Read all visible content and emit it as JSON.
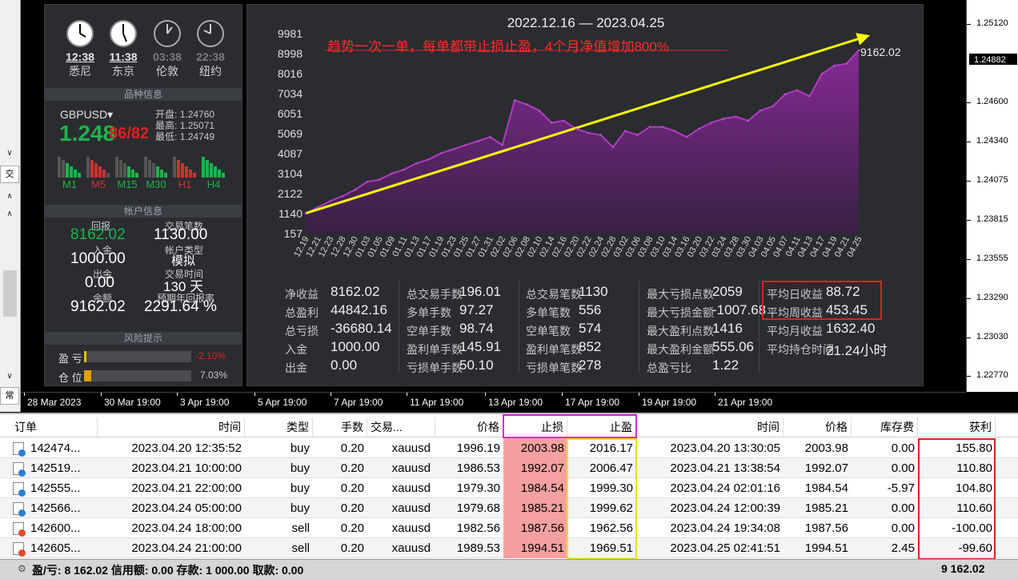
{
  "left_strip": {
    "tab1": "交",
    "tab2": "常"
  },
  "info": {
    "clocks": [
      {
        "time": "12:38",
        "city": "悉尼",
        "active": true
      },
      {
        "time": "11:38",
        "city": "东京",
        "active": true
      },
      {
        "time": "03:38",
        "city": "伦敦",
        "active": false
      },
      {
        "time": "22:38",
        "city": "纽约",
        "active": false
      }
    ],
    "sec_product": "品种信息",
    "symbol": "GBPUSD",
    "bid_big": "1.248",
    "bid_small": "86/82",
    "open_label": "开盘:",
    "open": "1.24760",
    "high_label": "最高:",
    "high": "1.25071",
    "low_label": "最低:",
    "low": "1.24749",
    "timeframes": [
      "M1",
      "M5",
      "M15",
      "M30",
      "H1",
      "H4"
    ],
    "sec_account": "帐户信息",
    "return_label": "回报",
    "return_value": "8162.02",
    "trades_label": "交易笔数",
    "trades_value": "1130.00",
    "deposit_label": "入金",
    "deposit_value": "1000.00",
    "acct_type_label": "帐户类型",
    "acct_type_value": "模拟",
    "withdraw_label": "出金",
    "withdraw_value": "0.00",
    "trade_time_label": "交易时间",
    "trade_time_value": "130 天",
    "balance_label": "余额",
    "balance_value": "9162.02",
    "annual_label": "预期年回报率",
    "annual_value": "2291.64 %",
    "sec_risk": "风险提示",
    "pl_label": "盈   亏",
    "pl_value": "-2.10%",
    "pl_fill": 0.021,
    "pos_label": "仓   位",
    "pos_value": "7.03%",
    "pos_fill": 0.0703
  },
  "chart": {
    "date_range": "2022.12.16 — 2023.04.25",
    "annotation": "趋势一次一单，每单都带止损止盈，4个月净值增加800%",
    "last_value_label": "9162.02",
    "y_ticks": [
      "9981",
      "8998",
      "8016",
      "7034",
      "6051",
      "5069",
      "4087",
      "3104",
      "2122",
      "1140",
      "157"
    ],
    "x_labels": [
      "12.19",
      "12.21",
      "12.23",
      "12.28",
      "12.30",
      "01.03",
      "01.05",
      "01.09",
      "01.11",
      "01.13",
      "01.17",
      "01.19",
      "01.23",
      "01.25",
      "01.27",
      "01.31",
      "02.02",
      "02.06",
      "02.08",
      "02.10",
      "02.14",
      "02.16",
      "02.20",
      "02.22",
      "02.24",
      "02.28",
      "03.02",
      "03.06",
      "03.08",
      "03.10",
      "03.14",
      "03.16",
      "03.20",
      "03.22",
      "03.24",
      "03.28",
      "03.30",
      "04.03",
      "04.05",
      "04.07",
      "04.11",
      "04.13",
      "04.17",
      "04.19",
      "04.21",
      "04.25"
    ]
  },
  "chart_data": {
    "type": "area",
    "x": [
      "12.19",
      "12.21",
      "12.23",
      "12.28",
      "12.30",
      "01.03",
      "01.05",
      "01.09",
      "01.11",
      "01.13",
      "01.17",
      "01.19",
      "01.23",
      "01.25",
      "01.27",
      "01.31",
      "02.02",
      "02.06",
      "02.08",
      "02.10",
      "02.14",
      "02.16",
      "02.20",
      "02.22",
      "02.24",
      "02.28",
      "03.02",
      "03.06",
      "03.08",
      "03.10",
      "03.14",
      "03.16",
      "03.20",
      "03.22",
      "03.24",
      "03.28",
      "03.30",
      "04.03",
      "04.05",
      "04.07",
      "04.11",
      "04.13",
      "04.17",
      "04.19",
      "04.21",
      "04.25"
    ],
    "series": [
      {
        "values": [
          1140,
          1450,
          1750,
          2000,
          2300,
          2700,
          2800,
          3100,
          3300,
          3600,
          3800,
          4100,
          4300,
          4500,
          4700,
          4900,
          4500,
          6700,
          6500,
          6200,
          5600,
          5700,
          5300,
          5100,
          5000,
          4400,
          5200,
          5000,
          5400,
          5400,
          5200,
          4900,
          5300,
          5600,
          5800,
          5900,
          5700,
          6200,
          6400,
          7000,
          7200,
          6900,
          8000,
          8400,
          8500,
          9162
        ]
      }
    ],
    "ylim": [
      157,
      9981
    ],
    "trend_arrow": {
      "from": 1150,
      "to": 9900
    }
  },
  "stats": {
    "col1": [
      [
        "净收益",
        "8162.02"
      ],
      [
        "总盈利",
        "44842.16"
      ],
      [
        "总亏损",
        "-36680.14"
      ],
      [
        "入金",
        "1000.00"
      ],
      [
        "出金",
        "0.00"
      ]
    ],
    "col2": [
      [
        "总交易手数",
        "196.01"
      ],
      [
        "多单手数",
        "97.27"
      ],
      [
        "空单手数",
        "98.74"
      ],
      [
        "盈利单手数",
        "145.91"
      ],
      [
        "亏损单手数",
        "50.10"
      ]
    ],
    "col3": [
      [
        "总交易笔数",
        "1130"
      ],
      [
        "多单笔数",
        "556"
      ],
      [
        "空单笔数",
        "574"
      ],
      [
        "盈利单笔数",
        "852"
      ],
      [
        "亏损单笔数",
        "278"
      ]
    ],
    "col4": [
      [
        "最大亏损点数",
        "2059"
      ],
      [
        "最大亏损金额",
        "-1007.68"
      ],
      [
        "最大盈利点数",
        "1416"
      ],
      [
        "最大盈利金额",
        "555.06"
      ],
      [
        "总盈亏比",
        "1.22"
      ]
    ],
    "col5": [
      [
        "平均日收益",
        "88.72"
      ],
      [
        "平均周收益",
        "453.45"
      ],
      [
        "平均月收益",
        "1632.40"
      ],
      [
        "平均持仓时间",
        "21.24小时"
      ]
    ]
  },
  "price_axis": {
    "labels": [
      "1.25120",
      "1.24600",
      "1.24340",
      "1.24075",
      "1.23815",
      "1.23555",
      "1.23290",
      "1.23030",
      "1.22770"
    ],
    "current": "1.24882"
  },
  "time_axis": [
    "28 Mar 2023",
    "30 Mar 19:00",
    "3 Apr 19:00",
    "5 Apr 19:00",
    "7 Apr 19:00",
    "11 Apr 19:00",
    "13 Apr 19:00",
    "17 Apr 19:00",
    "19 Apr 19:00",
    "21 Apr 19:00"
  ],
  "table": {
    "headers": [
      "订单",
      "时间",
      "类型",
      "手数",
      "交易...",
      "价格",
      "止损",
      "止盈",
      "时间",
      "价格",
      "库存费",
      "获利"
    ],
    "rows": [
      [
        "142474...",
        "2023.04.20 12:35:52",
        "buy",
        "0.20",
        "xauusd",
        "1996.19",
        "2003.98",
        "2016.17",
        "2023.04.20 13:30:05",
        "2003.98",
        "0.00",
        "155.80"
      ],
      [
        "142519...",
        "2023.04.21 10:00:00",
        "buy",
        "0.20",
        "xauusd",
        "1986.53",
        "1992.07",
        "2006.47",
        "2023.04.21 13:38:54",
        "1992.07",
        "0.00",
        "110.80"
      ],
      [
        "142555...",
        "2023.04.21 22:00:00",
        "buy",
        "0.20",
        "xauusd",
        "1979.30",
        "1984.54",
        "1999.30",
        "2023.04.24 02:01:16",
        "1984.54",
        "-5.97",
        "104.80"
      ],
      [
        "142566...",
        "2023.04.24 05:00:00",
        "buy",
        "0.20",
        "xauusd",
        "1979.68",
        "1985.21",
        "1999.62",
        "2023.04.24 12:00:39",
        "1985.21",
        "0.00",
        "110.60"
      ],
      [
        "142600...",
        "2023.04.24 18:00:00",
        "sell",
        "0.20",
        "xauusd",
        "1982.56",
        "1987.56",
        "1962.56",
        "2023.04.24 19:34:08",
        "1987.56",
        "0.00",
        "-100.00"
      ],
      [
        "142605...",
        "2023.04.24 21:00:00",
        "sell",
        "0.20",
        "xauusd",
        "1989.53",
        "1994.51",
        "1969.51",
        "2023.04.25 02:41:51",
        "1994.51",
        "2.45",
        "-99.60"
      ]
    ]
  },
  "status": {
    "text": "盈/亏: 8 162.02  信用额: 0.00  存款: 1 000.00  取款: 0.00",
    "total": "9 162.02"
  },
  "colors": {
    "highlight_red": "#e02020",
    "highlight_magenta": "#e020e0",
    "highlight_yellow": "#f0e000",
    "sl_fill": "#f5a0a0",
    "trend": "#ffff00",
    "equity_line": "#b03cc0"
  }
}
